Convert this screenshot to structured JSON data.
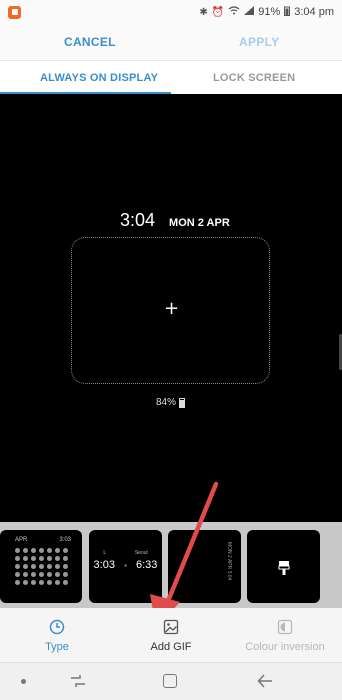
{
  "status_bar": {
    "battery": "91%",
    "time": "3:04 pm",
    "icons": [
      "bluetooth-icon",
      "alarm-icon",
      "wifi-icon",
      "signal-icon",
      "battery-icon"
    ]
  },
  "action_bar": {
    "cancel_label": "CANCEL",
    "apply_label": "APPLY"
  },
  "tabs": [
    {
      "label": "ALWAYS ON DISPLAY",
      "selected": true
    },
    {
      "label": "LOCK SCREEN",
      "selected": false
    }
  ],
  "preview": {
    "time": "3:04",
    "date": "MON 2 APR",
    "battery": "84%",
    "add_icon": "plus-icon"
  },
  "thumbnails": {
    "thumb1": {
      "month": "APR",
      "time": "3:03"
    },
    "thumb2": {
      "city1": "L",
      "city2": "Seoul",
      "time1": "3:03",
      "time2": "6:33"
    },
    "thumb3": {
      "text": "MON 2 APR 3:04"
    }
  },
  "bottom_tabs": [
    {
      "label": "Type",
      "icon": "clock-icon",
      "selected": true
    },
    {
      "label": "Add GIF",
      "icon": "image-icon",
      "selected": false
    },
    {
      "label": "Colour inversion",
      "icon": "colour-inversion-icon",
      "enabled": false
    }
  ],
  "colors": {
    "accent": "#3a8fc8",
    "apply_disabled": "#aaccea",
    "arrow": "#e14b4b",
    "preview_bg": "#000000"
  }
}
